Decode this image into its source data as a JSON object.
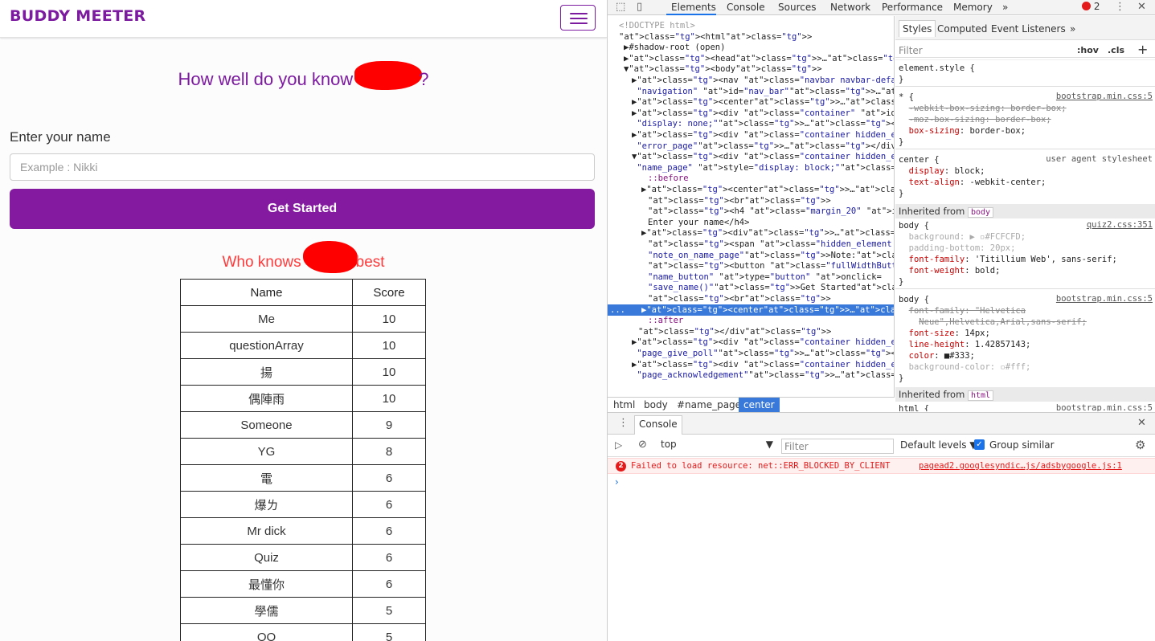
{
  "page": {
    "brand": "BUDDY MEETER",
    "headline_before": "How well do you know",
    "headline_after": "?",
    "name_label": "Enter your name",
    "name_placeholder": "Example : Nikki",
    "start_button": "Get Started",
    "best_before": "Who knows",
    "best_after": "best",
    "table": {
      "headers": [
        "Name",
        "Score"
      ],
      "rows": [
        [
          "Me",
          "10"
        ],
        [
          "questionArray",
          "10"
        ],
        [
          "揚",
          "10"
        ],
        [
          "偶陣雨",
          "10"
        ],
        [
          "Someone",
          "9"
        ],
        [
          "YG",
          "8"
        ],
        [
          "電",
          "6"
        ],
        [
          "爆ㄌ",
          "6"
        ],
        [
          "Mr dick",
          "6"
        ],
        [
          "Quiz",
          "6"
        ],
        [
          "最懂你",
          "6"
        ],
        [
          "學儒",
          "5"
        ],
        [
          "OO",
          "5"
        ]
      ]
    }
  },
  "devtools": {
    "tabs": [
      "Elements",
      "Console",
      "Sources",
      "Network",
      "Performance",
      "Memory"
    ],
    "more_tabs": "»",
    "error_count": "2",
    "styles_tabs": [
      "Styles",
      "Computed",
      "Event Listeners"
    ],
    "styles_more": "»",
    "filter_placeholder": "Filter",
    "hov": ":hov",
    "cls": ".cls",
    "breadcrumb": [
      "html",
      "body",
      "#name_page",
      "center"
    ],
    "console_tab": "Console",
    "context": "top",
    "console_filter_placeholder": "Filter",
    "default_levels": "Default levels ▼",
    "group_similar": "Group similar",
    "error_badge": "2",
    "error_message": "Failed to load resource: net::ERR_BLOCKED_BY_CLIENT",
    "error_source": "pagead2.googlesyndic…js/adsbygoogle.js:1",
    "prompt": "›",
    "elements_marker": "...",
    "inherited_label": "Inherited from",
    "inherited_body_tag": "body",
    "inherited_html_tag": "html"
  },
  "colors": {
    "brand_purple": "#7d1ba0",
    "button_purple": "#841aa0",
    "red_title": "#ff3b3b",
    "selection_blue": "#3879d9"
  }
}
